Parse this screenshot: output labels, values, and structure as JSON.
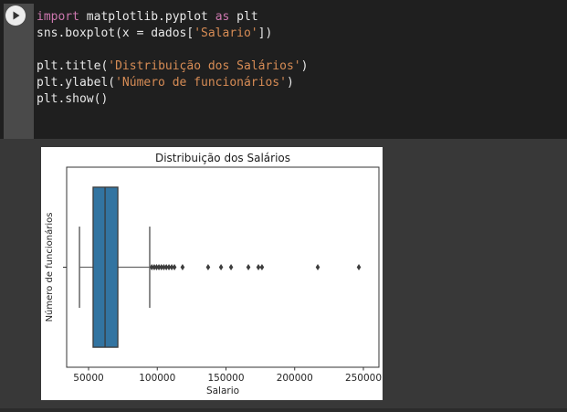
{
  "editor": {
    "token_colors": {
      "kw": "#cd78af",
      "str": "#d78c55",
      "pl": "#e8e8e8"
    },
    "code_lines": [
      [
        {
          "t": "import",
          "c": "kw"
        },
        {
          "t": " matplotlib.pyplot ",
          "c": "pl"
        },
        {
          "t": "as",
          "c": "kw"
        },
        {
          "t": " plt",
          "c": "pl"
        }
      ],
      [
        {
          "t": "sns.boxplot(x = dados[",
          "c": "pl"
        },
        {
          "t": "'Salario'",
          "c": "str"
        },
        {
          "t": "])",
          "c": "pl"
        }
      ],
      [],
      [
        {
          "t": "plt.title(",
          "c": "pl"
        },
        {
          "t": "'Distribuição dos Salários'",
          "c": "str"
        },
        {
          "t": ")",
          "c": "pl"
        }
      ],
      [
        {
          "t": "plt.ylabel(",
          "c": "pl"
        },
        {
          "t": "'Número de funcionários'",
          "c": "str"
        },
        {
          "t": ")",
          "c": "pl"
        }
      ],
      [
        {
          "t": "plt.show()",
          "c": "pl"
        }
      ]
    ]
  },
  "run_button": {
    "icon": "play-icon",
    "circle_color": "#ececec",
    "glyph_color": "#323232"
  },
  "chart_data": {
    "type": "boxplot",
    "orientation": "horizontal",
    "title": "Distribuição dos Salários",
    "xlabel": "Salario",
    "ylabel": "Número de funcionários",
    "xlim": [
      34050,
      261300
    ],
    "xticks": [
      50000,
      100000,
      150000,
      200000,
      250000
    ],
    "grid": false,
    "box": {
      "whisker_low": 43400,
      "q1": 53300,
      "median": 62000,
      "q3": 71300,
      "whisker_high": 94500,
      "fliers": [
        96000,
        97800,
        99500,
        101200,
        103000,
        104800,
        106600,
        108500,
        110500,
        112500,
        118400,
        137000,
        146400,
        153700,
        166300,
        173600,
        176200,
        216800,
        246700
      ]
    },
    "colors": {
      "box_fill": "#3274a1",
      "box_edge": "#3a3a3a",
      "whisker": "#666666",
      "flier": "#3d3d3d",
      "frame": "#333333",
      "text": "#262626",
      "title_text": "#1c1c1c",
      "figure_bg": "#ffffff"
    }
  }
}
